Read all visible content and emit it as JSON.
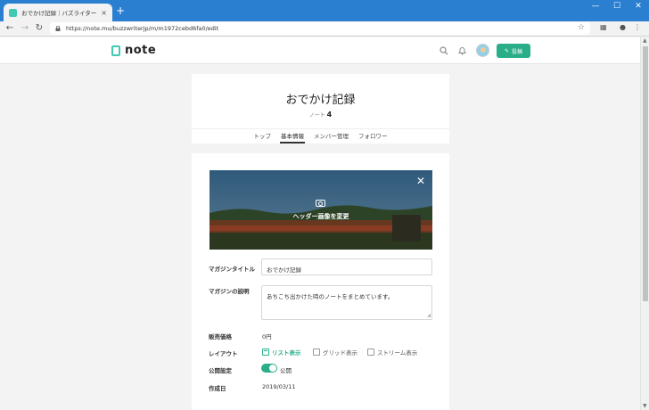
{
  "browser": {
    "tab_title": "おでかけ記録｜バズライター｜note",
    "tab_close": "×",
    "new_tab": "+",
    "url": "https://note.mu/buzzwriterjp/m/m1972cebd6fa0/edit",
    "window_controls": [
      "—",
      "☐",
      "✕"
    ]
  },
  "header": {
    "logo_text": "note",
    "post_button": "投稿",
    "icons": [
      "search-icon",
      "bell-icon",
      "avatar"
    ]
  },
  "magazine": {
    "title": "おでかけ記録",
    "note_label": "ノート",
    "note_count": "4",
    "tabs": [
      {
        "label": "トップ",
        "active": false
      },
      {
        "label": "基本情報",
        "active": true
      },
      {
        "label": "メンバー管理",
        "active": false
      },
      {
        "label": "フォロワー",
        "active": false
      }
    ]
  },
  "editor": {
    "header_image_label": "ヘッダー画像を変更",
    "close": "✕",
    "fields": {
      "title_label": "マガジンタイトル",
      "title_value": "おでかけ記録",
      "description_label": "マガジンの説明",
      "description_value": "あちこち出かけた時のノートをまとめています。",
      "price_label": "販売価格",
      "price_value": "0円",
      "layout_label": "レイアウト",
      "layout_options": [
        {
          "label": "リスト表示",
          "selected": true
        },
        {
          "label": "グリッド表示",
          "selected": false
        },
        {
          "label": "ストリーム表示",
          "selected": false
        }
      ],
      "visibility_label": "公開設定",
      "visibility_value": "公開",
      "visibility_on": true,
      "created_label": "作成日",
      "created_value": "2019/03/11"
    }
  },
  "colors": {
    "accent": "#2aae8a",
    "titlebar": "#2b7fd0"
  }
}
